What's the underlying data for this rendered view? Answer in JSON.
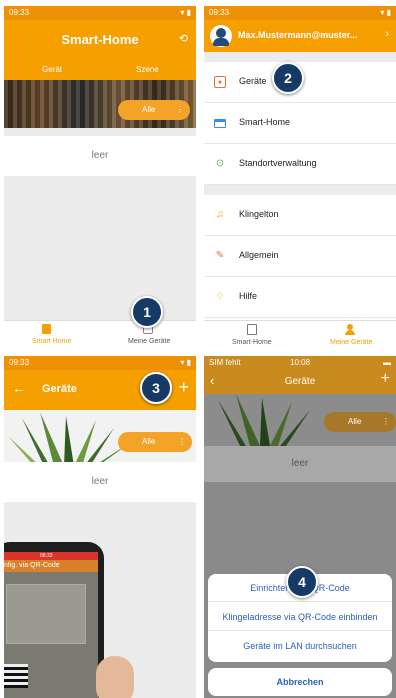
{
  "panel1": {
    "status_time": "09:33",
    "title": "Smart-Home",
    "tab_device": "Gerät",
    "tab_scene": "Szene",
    "filter_label": "Alle",
    "empty_text": "leer",
    "nav_left": "Smart Home",
    "nav_right": "Meine Geräte",
    "badge": "1"
  },
  "panel2": {
    "status_time": "09:33",
    "account": "Max.Mustermann@muster...",
    "badge": "2",
    "items": [
      {
        "label": "Geräte",
        "icon": "device-icon"
      },
      {
        "label": "Smart-Home",
        "icon": "smart-home-icon"
      },
      {
        "label": "Standortverwaltung",
        "icon": "location-icon"
      },
      {
        "label": "Klingelton",
        "icon": "music-icon"
      },
      {
        "label": "Allgemein",
        "icon": "wrench-icon"
      },
      {
        "label": "Hilfe",
        "icon": "lightbulb-icon"
      }
    ],
    "nav_left": "Smart-Home",
    "nav_right": "Meine Geräte"
  },
  "panel3": {
    "status_time": "09:33",
    "title": "Geräte",
    "filter_label": "Alle",
    "empty_text": "leer",
    "badge": "3",
    "phone_status_time": "08:33",
    "phone_header": "nfig. via QR-Code"
  },
  "panel4": {
    "status_carrier": "SIM fehlt",
    "status_time": "10:08",
    "title": "Geräte",
    "filter_label": "Alle",
    "empty_text": "leer",
    "badge": "4",
    "sheet_option1": "Einrichten/I          via QR-Code",
    "sheet_option2": "Klingeladresse via QR-Code einbinden",
    "sheet_option3": "Geräte im LAN durchsuchen",
    "cancel": "Abbrechen"
  },
  "colors": {
    "accent": "#f5a000",
    "badge": "#163a66",
    "link": "#2a62b8"
  }
}
